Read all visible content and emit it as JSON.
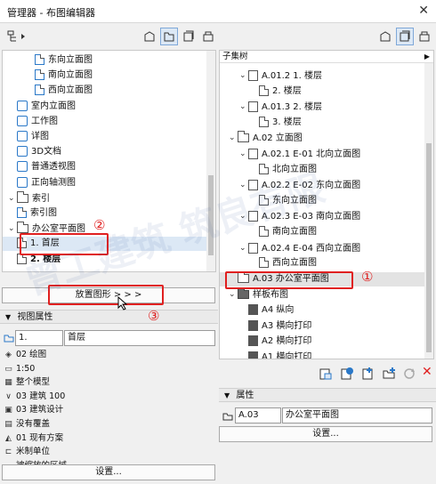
{
  "window": {
    "title": "管理器 - 布图编辑器",
    "close": "✕"
  },
  "watermark": "曾工建筑   筑良有限",
  "left_tree": {
    "items": [
      {
        "label": "东向立面图",
        "icon": "elevation-icon",
        "level": 3
      },
      {
        "label": "南向立面图",
        "icon": "elevation-icon",
        "level": 3
      },
      {
        "label": "西向立面图",
        "icon": "elevation-icon",
        "level": 3
      },
      {
        "label": "室内立面图",
        "icon": "interior-elevation-icon",
        "level": 1
      },
      {
        "label": "工作图",
        "icon": "worksheet-icon",
        "level": 1
      },
      {
        "label": "详图",
        "icon": "detail-icon",
        "level": 1
      },
      {
        "label": "3D文档",
        "icon": "3d-document-icon",
        "level": 1
      },
      {
        "label": "普通透视图",
        "icon": "perspective-icon",
        "level": 1
      },
      {
        "label": "正向轴测图",
        "icon": "axonometry-icon",
        "level": 1
      },
      {
        "label": "索引",
        "icon": "folder-icon",
        "level": 0,
        "expanded": true
      },
      {
        "label": "索引图",
        "icon": "index-icon",
        "level": 1
      },
      {
        "label": "办公室平面图",
        "icon": "folder-icon",
        "level": 0,
        "expanded": true
      },
      {
        "label": "1. 首层",
        "icon": "floor-plan-icon",
        "level": 1,
        "selected": true
      },
      {
        "label": "2. 楼层",
        "icon": "floor-plan-icon",
        "level": 1,
        "bold": true
      }
    ]
  },
  "place_button": "放置图形 > > >",
  "view_props": {
    "header": "视图属性",
    "id_value": "1.",
    "name_value": "首层",
    "rows": [
      {
        "icon": "layer-icon",
        "text": "02 绘图"
      },
      {
        "icon": "scale-icon",
        "text": "1:50"
      },
      {
        "icon": "model-icon",
        "text": "整个模型"
      },
      {
        "icon": "pen-icon",
        "text": "03 建筑 100"
      },
      {
        "icon": "mvo-icon",
        "text": "03 建筑设计"
      },
      {
        "icon": "override-icon",
        "text": "没有覆盖"
      },
      {
        "icon": "renovation-icon",
        "text": "01 现有方案"
      },
      {
        "icon": "unit-icon",
        "text": "米制单位"
      },
      {
        "icon": "zoom-icon",
        "text": "被缩放的区域"
      }
    ],
    "settings": "设置..."
  },
  "right_tree": {
    "header": "子集树",
    "items": [
      {
        "label": "A.01.2 1. 楼层",
        "level": 1,
        "kind": "drawing",
        "chevron": true
      },
      {
        "label": "2. 楼层",
        "level": 2,
        "kind": "view"
      },
      {
        "label": "A.01.3 2. 楼层",
        "level": 1,
        "kind": "drawing",
        "chevron": true
      },
      {
        "label": "3. 楼层",
        "level": 2,
        "kind": "view"
      },
      {
        "label": "A.02 立面图",
        "level": 0,
        "kind": "folder",
        "chevron": true
      },
      {
        "label": "A.02.1 E-01 北向立面图",
        "level": 1,
        "kind": "drawing",
        "chevron": true
      },
      {
        "label": "北向立面图",
        "level": 2,
        "kind": "view"
      },
      {
        "label": "A.02.2 E-02 东向立面图",
        "level": 1,
        "kind": "drawing",
        "chevron": true
      },
      {
        "label": "东向立面图",
        "level": 2,
        "kind": "view"
      },
      {
        "label": "A.02.3 E-03 南向立面图",
        "level": 1,
        "kind": "drawing",
        "chevron": true
      },
      {
        "label": "南向立面图",
        "level": 2,
        "kind": "view"
      },
      {
        "label": "A.02.4 E-04 西向立面图",
        "level": 1,
        "kind": "drawing",
        "chevron": true
      },
      {
        "label": "西向立面图",
        "level": 2,
        "kind": "view"
      },
      {
        "label": "A.03 办公室平面图",
        "level": 0,
        "kind": "folder",
        "selected": true
      },
      {
        "label": "样板布图",
        "level": 0,
        "kind": "folder-dark",
        "chevron": true
      },
      {
        "label": "A4 纵向",
        "level": 1,
        "kind": "page-dark"
      },
      {
        "label": "A3 横向打印",
        "level": 1,
        "kind": "page-dark"
      },
      {
        "label": "A2 横向打印",
        "level": 1,
        "kind": "page-dark"
      },
      {
        "label": "A1 横向打印",
        "level": 1,
        "kind": "page-dark"
      }
    ]
  },
  "props": {
    "header": "属性",
    "id_value": "A.03",
    "name_value": "办公室平面图",
    "settings": "设置..."
  },
  "annotations": {
    "one": "①",
    "two": "②",
    "three": "③"
  }
}
